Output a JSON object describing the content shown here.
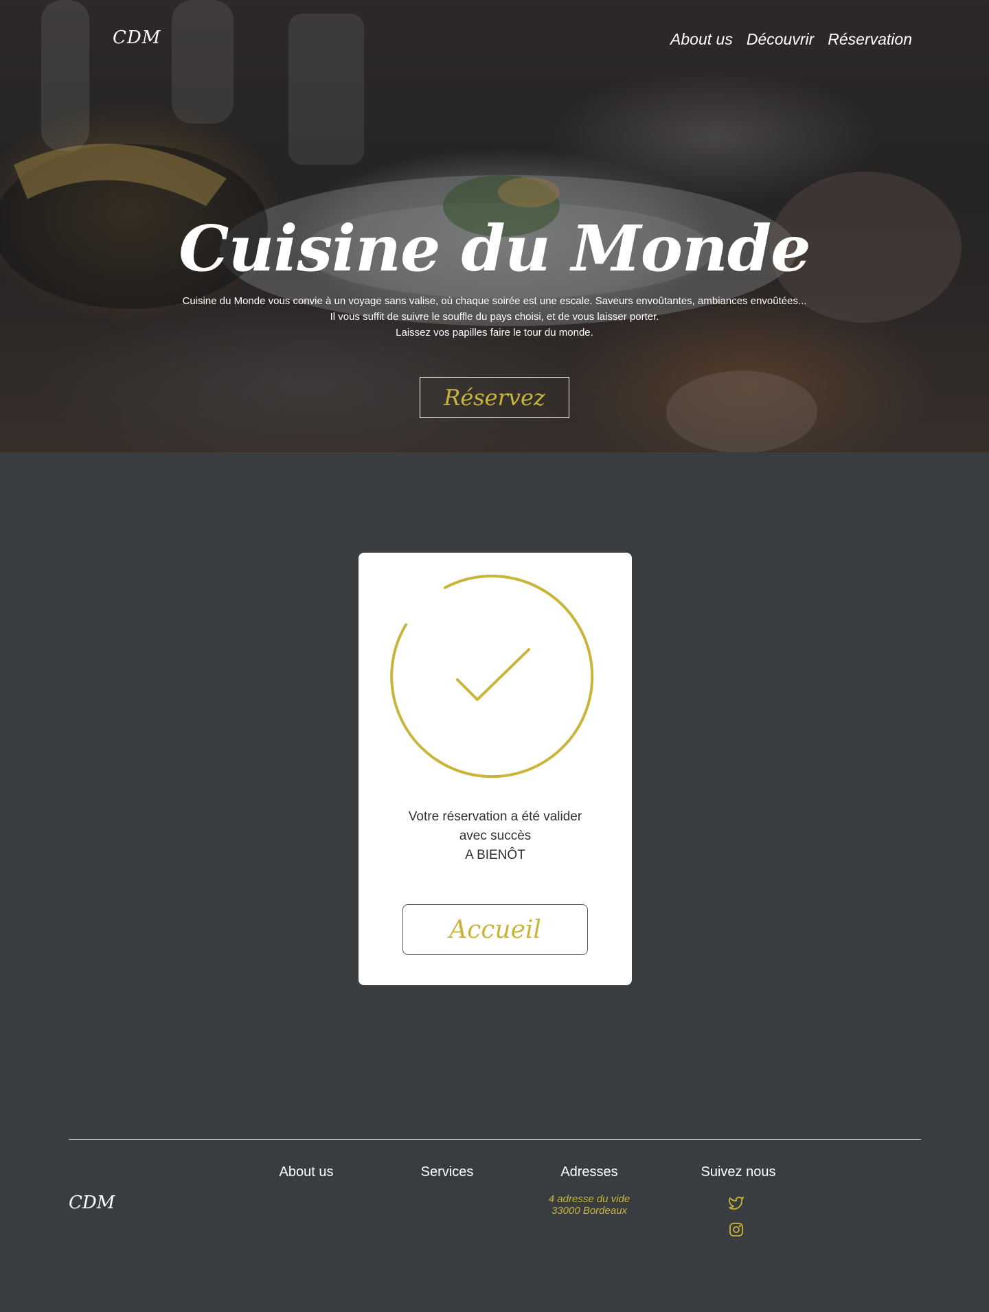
{
  "header": {
    "logo": "CDM",
    "nav": [
      "About us",
      "Découvrir",
      "Réservation"
    ]
  },
  "hero": {
    "title": "Cuisine du Monde",
    "lines": [
      "Cuisine du Monde vous convie à un voyage sans valise, où chaque soirée est une escale. Saveurs envoûtantes, ambiances envoûtées...",
      "Il vous suffit de suivre le souffle du pays choisi, et de vous laisser porter.",
      "Laissez vos papilles faire le tour du monde."
    ],
    "cta": "Réservez"
  },
  "confirmation": {
    "icon": "check-circle-icon",
    "lines": [
      "Votre réservation a été valider",
      "avec succès",
      "A BIENÔT"
    ],
    "button": "Accueil"
  },
  "footer": {
    "logo": "CDM",
    "columns": {
      "about": "About us",
      "services": "Services",
      "addresses": "Adresses",
      "follow": "Suivez nous"
    },
    "address_lines": [
      "4 adresse du vide",
      "33000 Bordeaux"
    ],
    "socials": [
      "twitter-icon",
      "instagram-icon"
    ]
  },
  "colors": {
    "accent": "#c9b43c",
    "background": "#3a3d40",
    "card": "#ffffff"
  }
}
